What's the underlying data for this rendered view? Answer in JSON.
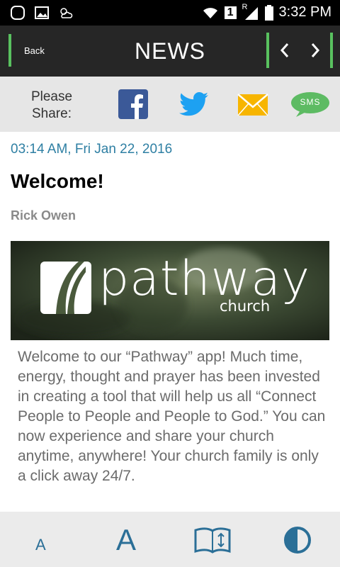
{
  "status_bar": {
    "time": "3:32 PM",
    "sim_number": "1",
    "roaming_letter": "R"
  },
  "nav": {
    "back_label": "Back",
    "title": "NEWS",
    "prev_glyph": "‹",
    "next_glyph": "›"
  },
  "share": {
    "label": "Please Share:",
    "sms_label": "SMS",
    "icons": [
      "facebook-icon",
      "twitter-icon",
      "email-icon",
      "sms-icon"
    ],
    "colors": {
      "facebook": "#3b5998",
      "twitter": "#1da1f2",
      "email": "#f7b500",
      "sms": "#5dbb63"
    }
  },
  "article": {
    "date": "03:14 AM, Fri Jan 22, 2016",
    "title": "Welcome!",
    "author": "Rick Owen",
    "banner": {
      "brand": "pathway",
      "sub": "church"
    },
    "body": "Welcome to our “Pathway” app! Much time, energy, thought and prayer has been invested in creating a tool that will help us all “Connect People to People and People to God.” You can now experience and share your church anytime, anywhere! Your church family is only a click away 24/7."
  },
  "footer": {
    "small_font_label": "A",
    "large_font_label": "A"
  },
  "colors": {
    "accent_green": "#59c15f",
    "link_blue": "#2e7fa3",
    "nav_bg": "#262626"
  }
}
